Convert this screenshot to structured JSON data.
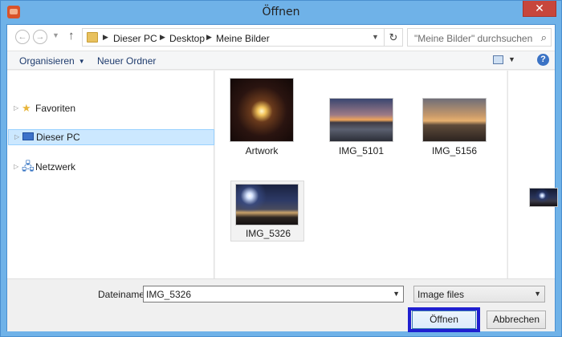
{
  "window": {
    "title": "Öffnen",
    "close_label": "✕"
  },
  "nav": {
    "breadcrumbs": [
      "Dieser PC",
      "Desktop",
      "Meine Bilder"
    ],
    "search_placeholder": "\"Meine Bilder\" durchsuchen"
  },
  "toolbar": {
    "organize_label": "Organisieren",
    "new_folder_label": "Neuer Ordner"
  },
  "sidebar": {
    "items": [
      {
        "label": "Favoriten"
      },
      {
        "label": "Dieser PC",
        "selected": true
      },
      {
        "label": "Netzwerk"
      }
    ]
  },
  "files": [
    {
      "name": "Artwork"
    },
    {
      "name": "IMG_5101"
    },
    {
      "name": "IMG_5156"
    },
    {
      "name": "IMG_5326",
      "selected": true
    }
  ],
  "footer": {
    "filename_label": "Dateiname:",
    "filename_value": "IMG_5326",
    "filetype_value": "Image files",
    "open_label": "Öffnen",
    "cancel_label": "Abbrechen"
  },
  "colors": {
    "highlight_frame": "#1f1fd0",
    "selection": "#cce8ff",
    "titlebar": "#6fb2e8"
  }
}
